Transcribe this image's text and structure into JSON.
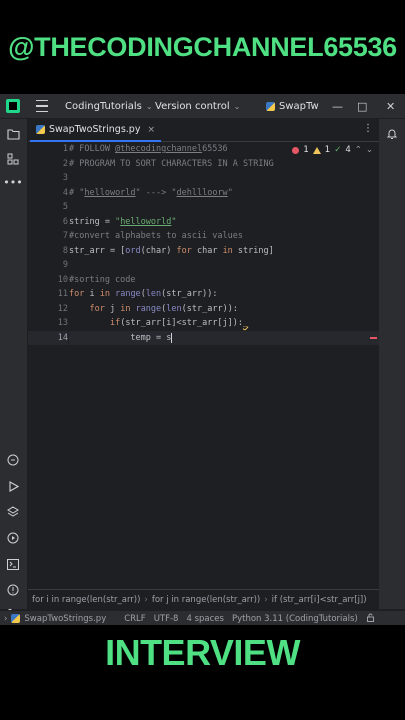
{
  "banner_top": "@THECODINGCHANNEL65536",
  "banner_bottom": "INTERVIEW",
  "titlebar": {
    "project": "CodingTutorials",
    "vcs": "Version control",
    "run_config": "SwapTw",
    "minimize": "—",
    "maximize": "□",
    "close": "✕"
  },
  "tab": {
    "name": "SwapTwoStrings.py",
    "close": "×",
    "more": "⋮"
  },
  "inspection": {
    "errors": "1",
    "warnings": "1",
    "ok": "4"
  },
  "line_numbers": [
    "1",
    "2",
    "3",
    "4",
    "5",
    "6",
    "7",
    "8",
    "9",
    "10",
    "11",
    "12",
    "13",
    "14"
  ],
  "code": {
    "l1_comment_prefix": "# FOLLOW ",
    "l1_handle": "@thecodingchannel",
    "l1_suffix": "65536",
    "l2": "# PROGRAM TO SORT CHARACTERS IN A STRING",
    "l4_prefix": "# \"",
    "l4_word1": "helloworld",
    "l4_mid": "\" ---> \"",
    "l4_word2": "dehllloorw",
    "l4_end": "\"",
    "l6_var": "string = ",
    "l6_q1": "\"",
    "l6_str": "helloworld",
    "l6_q2": "\"",
    "l7": "#convert alphabets to ascii values",
    "l8_a": "str_arr = [",
    "l8_ord": "ord",
    "l8_b": "(char) ",
    "l8_for": "for",
    "l8_c": " char ",
    "l8_in": "in",
    "l8_d": " string]",
    "l10": "#sorting code",
    "l11_for": "for",
    "l11_a": " i ",
    "l11_in": "in",
    "l11_range": " range",
    "l11_b": "(",
    "l11_len": "len",
    "l11_c": "(str_arr)):",
    "l12_for": "for",
    "l12_a": " j ",
    "l12_in": "in",
    "l12_range": " range",
    "l12_b": "(",
    "l12_len": "len",
    "l12_c": "(str_arr)):",
    "l13_if": "if",
    "l13_a": "(str_arr[i]<str_arr[j]):",
    "l13_warn": "_",
    "l14_a": "temp = s"
  },
  "breadcrumbs": [
    "for i in range(len(str_arr))",
    "for j in range(len(str_arr))",
    "if (str_arr[i]<str_arr[j])"
  ],
  "status": {
    "file": "SwapTwoStrings.py",
    "line_sep": "CRLF",
    "encoding": "UTF-8",
    "indent": "4 spaces",
    "interpreter": "Python 3.11 (CodingTutorials)"
  },
  "colors": {
    "banner_green": "#4ee083",
    "accent": "#3574f0",
    "error": "#e55765",
    "warning": "#f2c55c"
  },
  "icons": [
    "project-folder-icon",
    "structure-icon",
    "more-icon",
    "python-console-icon",
    "run-icon",
    "layers-icon",
    "services-icon",
    "terminal-icon",
    "problems-icon",
    "git-icon",
    "notifications-icon"
  ]
}
